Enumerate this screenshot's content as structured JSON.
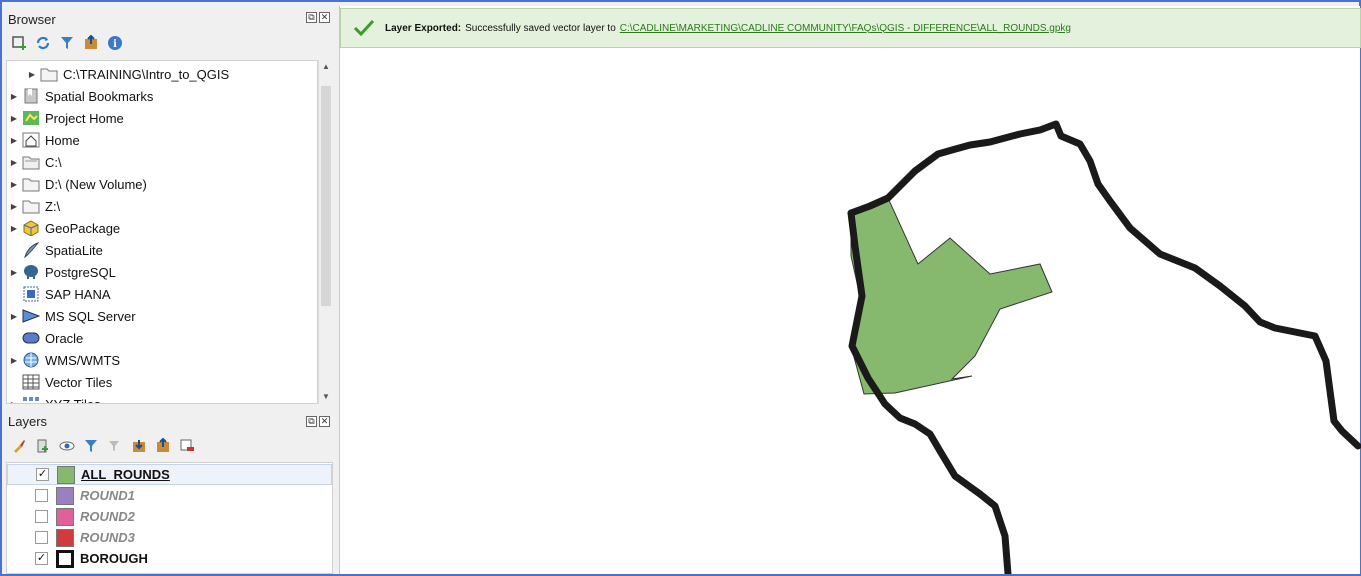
{
  "browser": {
    "title": "Browser",
    "items": [
      {
        "label": "C:\\TRAINING\\Intro_to_QGIS",
        "icon": "folder-icon",
        "expandable": true,
        "indent": true
      },
      {
        "label": "Spatial Bookmarks",
        "icon": "bookmark-icon",
        "expandable": true
      },
      {
        "label": "Project Home",
        "icon": "project-home-icon",
        "expandable": true
      },
      {
        "label": "Home",
        "icon": "home-icon",
        "expandable": true
      },
      {
        "label": "C:\\",
        "icon": "drive-icon",
        "expandable": true
      },
      {
        "label": "D:\\ (New Volume)",
        "icon": "folder-icon",
        "expandable": true
      },
      {
        "label": "Z:\\",
        "icon": "folder-icon",
        "expandable": true
      },
      {
        "label": "GeoPackage",
        "icon": "geopackage-icon",
        "expandable": true
      },
      {
        "label": "SpatiaLite",
        "icon": "spatialite-icon",
        "expandable": false
      },
      {
        "label": "PostgreSQL",
        "icon": "postgresql-icon",
        "expandable": true
      },
      {
        "label": "SAP HANA",
        "icon": "sap-hana-icon",
        "expandable": false
      },
      {
        "label": "MS SQL Server",
        "icon": "mssql-icon",
        "expandable": true
      },
      {
        "label": "Oracle",
        "icon": "oracle-icon",
        "expandable": false
      },
      {
        "label": "WMS/WMTS",
        "icon": "globe-icon",
        "expandable": true
      },
      {
        "label": "Vector Tiles",
        "icon": "grid-icon",
        "expandable": false
      },
      {
        "label": "XYZ Tiles",
        "icon": "tiles-icon",
        "expandable": true
      }
    ]
  },
  "layers": {
    "title": "Layers",
    "items": [
      {
        "label": "ALL_ROUNDS",
        "checked": true,
        "color": "#86b86e",
        "active": true,
        "selected": true
      },
      {
        "label": "ROUND1",
        "checked": false,
        "color": "#9b7fc0",
        "active": false
      },
      {
        "label": "ROUND2",
        "checked": false,
        "color": "#e0609a",
        "active": false
      },
      {
        "label": "ROUND3",
        "checked": false,
        "color": "#d23b3b",
        "active": false
      },
      {
        "label": "BOROUGH",
        "checked": true,
        "color": "#ffffff",
        "outline": true,
        "active": true
      }
    ]
  },
  "message": {
    "title": "Layer Exported:",
    "text": "Successfully saved vector layer to",
    "link": "C:\\CADLINE\\MARKETING\\CADLINE COMMUNITY\\FAQs\\QGIS - DIFFERENCE\\ALL_ROUNDS.gpkg"
  },
  "colors": {
    "fill": "#86b86e",
    "boundary": "#1a1a1a",
    "message_bg": "#e4f1dc",
    "accent": "#4a73c9"
  }
}
